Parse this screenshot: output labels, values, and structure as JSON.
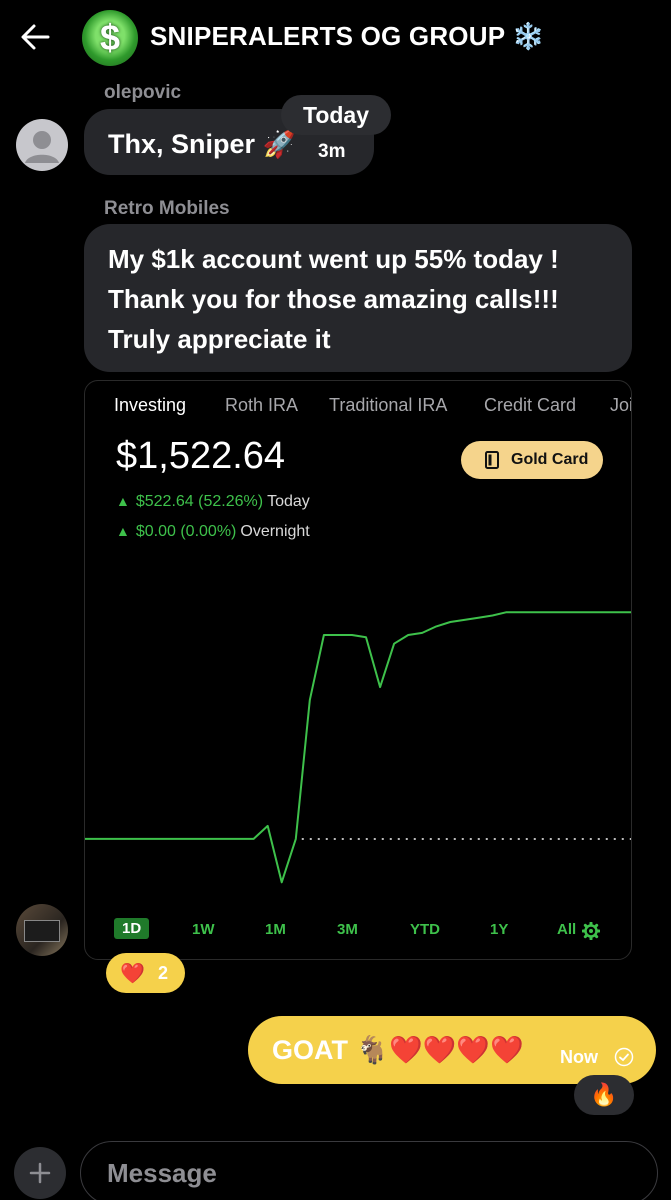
{
  "header": {
    "title": "SNIPERALERTS OG GROUP ❄️",
    "avatar_glyph": "$"
  },
  "date_pill": "Today",
  "messages": [
    {
      "sender": "olepovic",
      "text": "Thx, Sniper 🚀",
      "time": "3m"
    },
    {
      "sender": "Retro Mobiles",
      "lines": [
        "My $1k account went up 55% today !",
        "Thank you for those amazing calls!!!",
        "Truly appreciate it"
      ]
    }
  ],
  "screenshot": {
    "tabs": [
      "Investing",
      "Roth IRA",
      "Traditional IRA",
      "Credit Card",
      "Joi"
    ],
    "active_tab": "Investing",
    "balance": "$1,522.64",
    "gold_button": "Gold Card",
    "today_change": "$522.64 (52.26%)",
    "today_label": "Today",
    "overnight_change": "$0.00 (0.00%)",
    "overnight_label": "Overnight",
    "ranges": [
      "1D",
      "1W",
      "1M",
      "3M",
      "YTD",
      "1Y",
      "All"
    ],
    "selected_range": "1D",
    "colors": {
      "up": "#3ec14b",
      "gold": "#f5d48c"
    }
  },
  "chart_data": {
    "type": "line",
    "series": [
      {
        "values": [
          1000,
          1000,
          1000,
          1000,
          1000,
          1000,
          1000,
          1000,
          1000,
          1000,
          1000,
          1000,
          1000,
          1030,
          900,
          1000,
          1320,
          1470,
          1470,
          1470,
          1465,
          1350,
          1450,
          1470,
          1475,
          1490,
          1500,
          1505,
          1510,
          1515,
          1522.64,
          1522.64,
          1522.64,
          1522.64,
          1522.64,
          1522.64,
          1522.64,
          1522.64,
          1522.64,
          1522.64
        ]
      }
    ],
    "baseline": 1000,
    "grid": false
  },
  "reaction": {
    "emoji": "❤️",
    "count": "2"
  },
  "my_message": {
    "text": "GOAT 🐐❤️❤️❤️❤️",
    "time": "Now"
  },
  "my_reaction": "🔥",
  "composer": {
    "placeholder": "Message"
  }
}
